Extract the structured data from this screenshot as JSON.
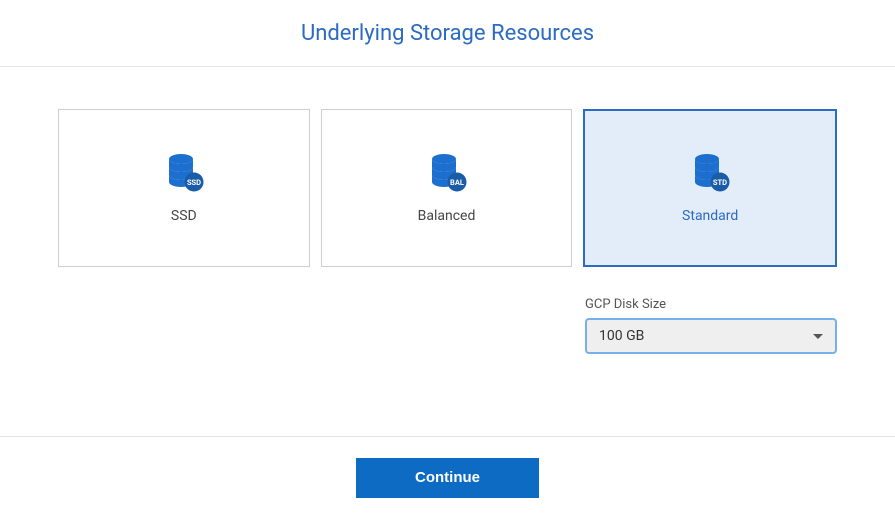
{
  "title": "Underlying Storage Resources",
  "options": [
    {
      "label": "SSD",
      "badge": "SSD",
      "selected": false
    },
    {
      "label": "Balanced",
      "badge": "BAL",
      "selected": false
    },
    {
      "label": "Standard",
      "badge": "STD",
      "selected": true
    }
  ],
  "disk": {
    "label": "GCP Disk Size",
    "value": "100 GB"
  },
  "actions": {
    "continue": "Continue"
  },
  "colors": {
    "primary": "#2c6bc3",
    "button_bg": "#0d6bc3",
    "selected_bg": "#e3edfa",
    "icon_fill": "#1d6fcf",
    "badge_fill": "#1a5ca8"
  }
}
